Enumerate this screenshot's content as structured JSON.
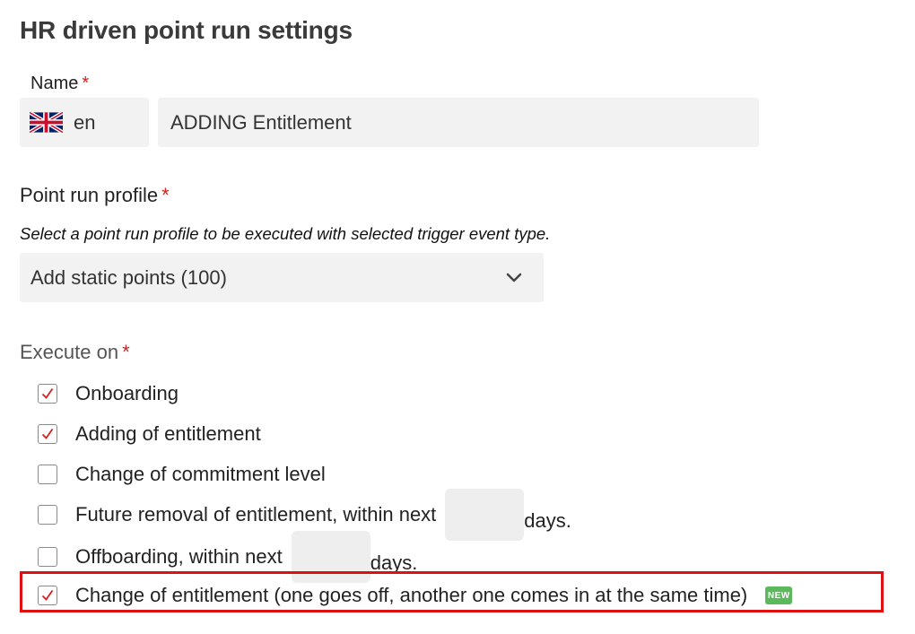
{
  "page": {
    "title": "HR driven point run settings"
  },
  "name_field": {
    "label": "Name",
    "required_marker": "*",
    "language_code": "en",
    "language_flag": "uk-flag-icon",
    "value": "ADDING Entitlement"
  },
  "point_run_profile": {
    "label": "Point run profile",
    "required_marker": "*",
    "description": "Select a point run profile to be executed with selected trigger event type.",
    "selected_value": "Add static points (100)"
  },
  "execute_on": {
    "label": "Execute on",
    "required_marker": "*",
    "options": [
      {
        "label": "Onboarding",
        "checked": true
      },
      {
        "label": "Adding of entitlement",
        "checked": true
      },
      {
        "label": "Change of commitment level",
        "checked": false
      },
      {
        "label": "Future removal of entitlement, within next",
        "checked": false,
        "days_value": "",
        "days_suffix": "days."
      },
      {
        "label": "Offboarding, within next",
        "checked": false,
        "days_value": "",
        "days_suffix": "days."
      },
      {
        "label": "Change of entitlement (one goes off, another one comes in at the same time)",
        "checked": true,
        "badge": "NEW",
        "highlighted": true
      }
    ]
  },
  "colors": {
    "checkmark": "#d21f1f",
    "required": "#d21f1f",
    "highlight_border": "#e01010",
    "badge_bg": "#5cb85c",
    "field_bg": "#f2f2f2"
  }
}
